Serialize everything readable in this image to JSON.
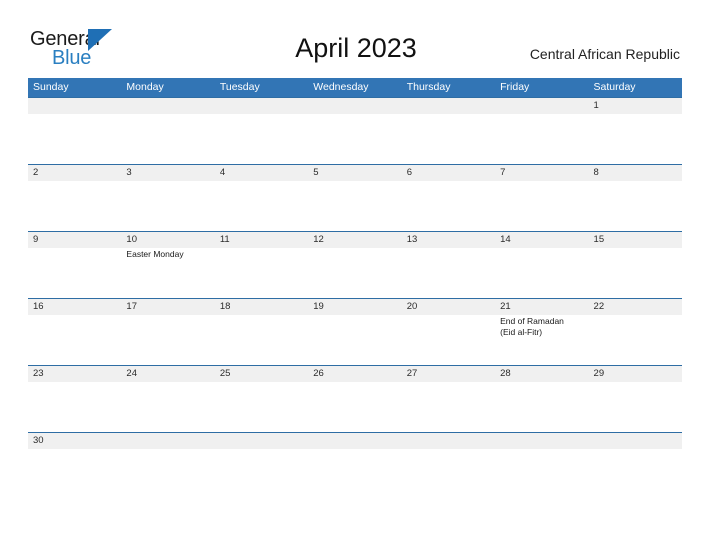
{
  "branding": {
    "logo_primary": "General",
    "logo_secondary": "Blue",
    "logo_triangle_icon": "triangle-icon",
    "accent_blue": "#2a7fc1",
    "header_blue": "#3275b5",
    "band_gray": "#f0f0f0",
    "separator_blue": "#2e6da4"
  },
  "header": {
    "title": "April 2023",
    "region": "Central African Republic"
  },
  "weekdays": [
    "Sunday",
    "Monday",
    "Tuesday",
    "Wednesday",
    "Thursday",
    "Friday",
    "Saturday"
  ],
  "calendar": {
    "month": "April",
    "year": "2023",
    "weeks": [
      {
        "days": [
          {
            "num": "",
            "event": ""
          },
          {
            "num": "",
            "event": ""
          },
          {
            "num": "",
            "event": ""
          },
          {
            "num": "",
            "event": ""
          },
          {
            "num": "",
            "event": ""
          },
          {
            "num": "",
            "event": ""
          },
          {
            "num": "1",
            "event": ""
          }
        ]
      },
      {
        "days": [
          {
            "num": "2",
            "event": ""
          },
          {
            "num": "3",
            "event": ""
          },
          {
            "num": "4",
            "event": ""
          },
          {
            "num": "5",
            "event": ""
          },
          {
            "num": "6",
            "event": ""
          },
          {
            "num": "7",
            "event": ""
          },
          {
            "num": "8",
            "event": ""
          }
        ]
      },
      {
        "days": [
          {
            "num": "9",
            "event": ""
          },
          {
            "num": "10",
            "event": "Easter Monday"
          },
          {
            "num": "11",
            "event": ""
          },
          {
            "num": "12",
            "event": ""
          },
          {
            "num": "13",
            "event": ""
          },
          {
            "num": "14",
            "event": ""
          },
          {
            "num": "15",
            "event": ""
          }
        ]
      },
      {
        "days": [
          {
            "num": "16",
            "event": ""
          },
          {
            "num": "17",
            "event": ""
          },
          {
            "num": "18",
            "event": ""
          },
          {
            "num": "19",
            "event": ""
          },
          {
            "num": "20",
            "event": ""
          },
          {
            "num": "21",
            "event": "End of Ramadan\n(Eid al-Fitr)"
          },
          {
            "num": "22",
            "event": ""
          }
        ]
      },
      {
        "days": [
          {
            "num": "23",
            "event": ""
          },
          {
            "num": "24",
            "event": ""
          },
          {
            "num": "25",
            "event": ""
          },
          {
            "num": "26",
            "event": ""
          },
          {
            "num": "27",
            "event": ""
          },
          {
            "num": "28",
            "event": ""
          },
          {
            "num": "29",
            "event": ""
          }
        ]
      },
      {
        "days": [
          {
            "num": "30",
            "event": ""
          },
          {
            "num": "",
            "event": ""
          },
          {
            "num": "",
            "event": ""
          },
          {
            "num": "",
            "event": ""
          },
          {
            "num": "",
            "event": ""
          },
          {
            "num": "",
            "event": ""
          },
          {
            "num": "",
            "event": ""
          }
        ]
      }
    ]
  }
}
